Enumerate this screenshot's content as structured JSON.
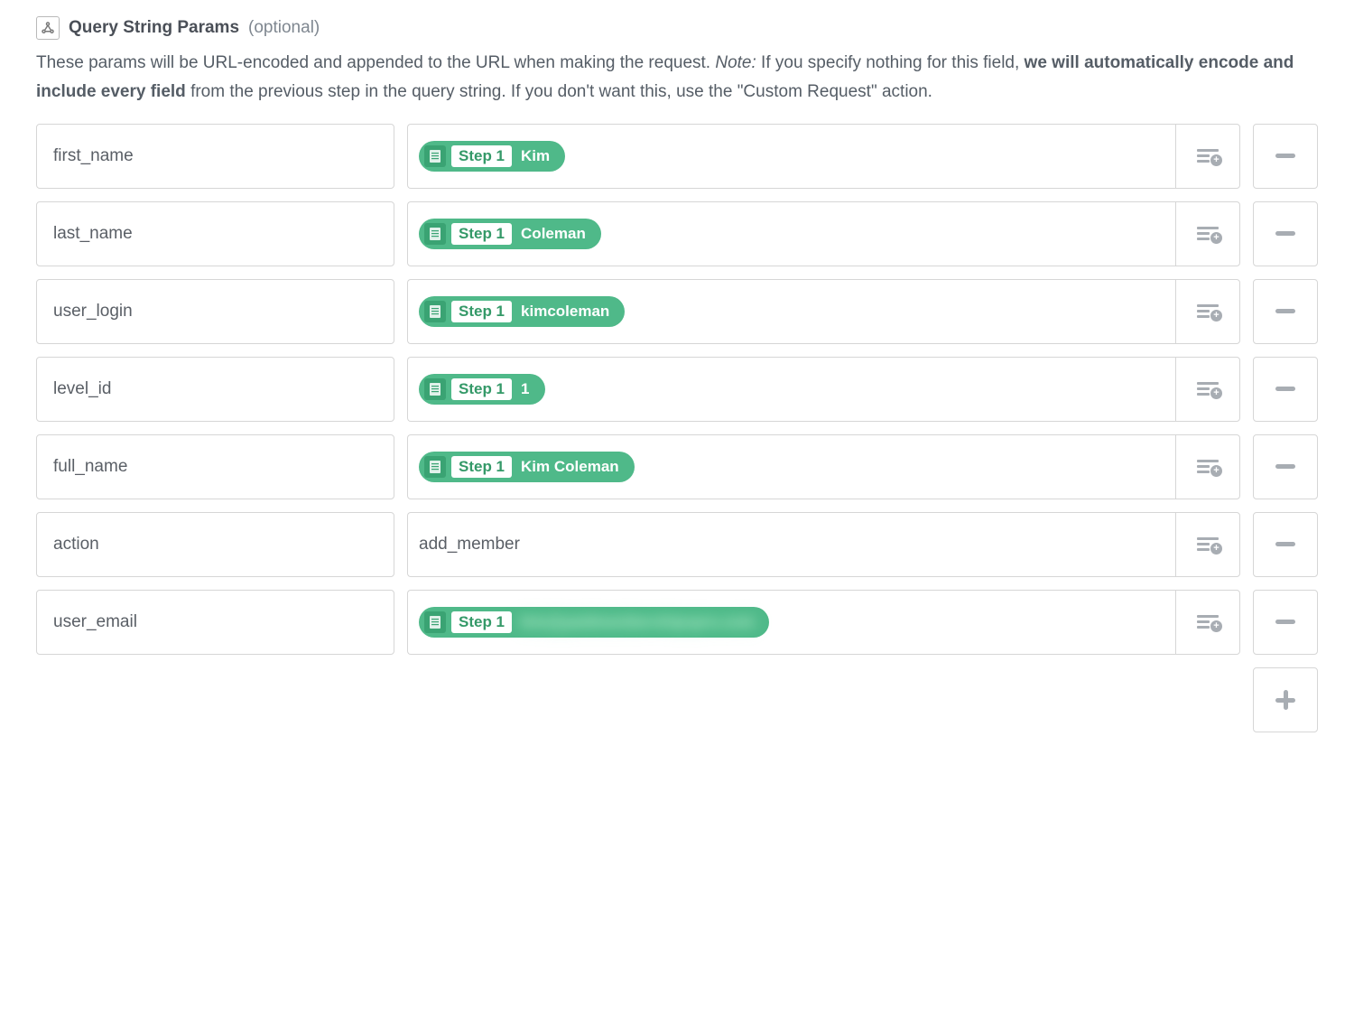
{
  "section": {
    "title": "Query String Params",
    "optional": "(optional)",
    "description_parts": {
      "p1": "These params will be URL-encoded and appended to the URL when making the request. ",
      "note_label": "Note:",
      "p2": " If you specify nothing for this field, ",
      "bold": "we will automatically encode and include every field",
      "p3": " from the previous step in the query string. If you don't want this, use the \"Custom Request\" action."
    }
  },
  "step_label": "Step 1",
  "params": {
    "0": {
      "key": "first_name",
      "type": "step",
      "step": "Step 1",
      "value": "Kim"
    },
    "1": {
      "key": "last_name",
      "type": "step",
      "step": "Step 1",
      "value": "Coleman"
    },
    "2": {
      "key": "user_login",
      "type": "step",
      "step": "Step 1",
      "value": "kimcoleman"
    },
    "3": {
      "key": "level_id",
      "type": "step",
      "step": "Step 1",
      "value": "1"
    },
    "4": {
      "key": "full_name",
      "type": "step",
      "step": "Step 1",
      "value": "Kim Coleman"
    },
    "5": {
      "key": "action",
      "type": "text",
      "value": "add_member"
    },
    "6": {
      "key": "user_email",
      "type": "step",
      "step": "Step 1",
      "value": "kim@paidmembershipspro.com",
      "blurred": true
    }
  }
}
